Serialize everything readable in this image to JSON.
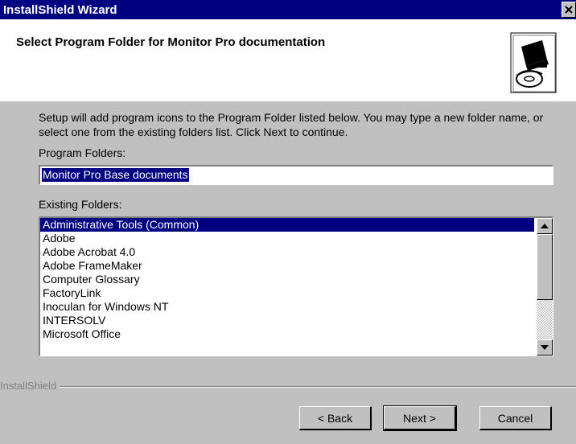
{
  "window": {
    "title": "InstallShield Wizard"
  },
  "header": {
    "title": "Select Program Folder for Monitor Pro documentation",
    "logo_icon": "installshield-computer-cd-icon"
  },
  "body": {
    "description": "Setup will add program icons to the Program Folder listed below.  You may type a new folder name, or select one from the existing folders list.  Click Next to continue.",
    "program_folders_label": "Program Folders:",
    "program_folders_value": "Monitor Pro Base documents",
    "existing_folders_label": "Existing Folders:",
    "existing_folders": [
      "Administrative Tools (Common)",
      "Adobe",
      "Adobe Acrobat 4.0",
      "Adobe FrameMaker",
      "Computer Glossary",
      "FactoryLink",
      "Inoculan for Windows NT",
      "INTERSOLV",
      "Microsoft Office"
    ],
    "selected_index": 0
  },
  "footer": {
    "brand": "InstallShield",
    "back_label": "< Back",
    "next_label": "Next >",
    "cancel_label": "Cancel"
  },
  "colors": {
    "titlebar": "#000080",
    "selection": "#000080",
    "dialog_bg": "#c0c0c0"
  }
}
